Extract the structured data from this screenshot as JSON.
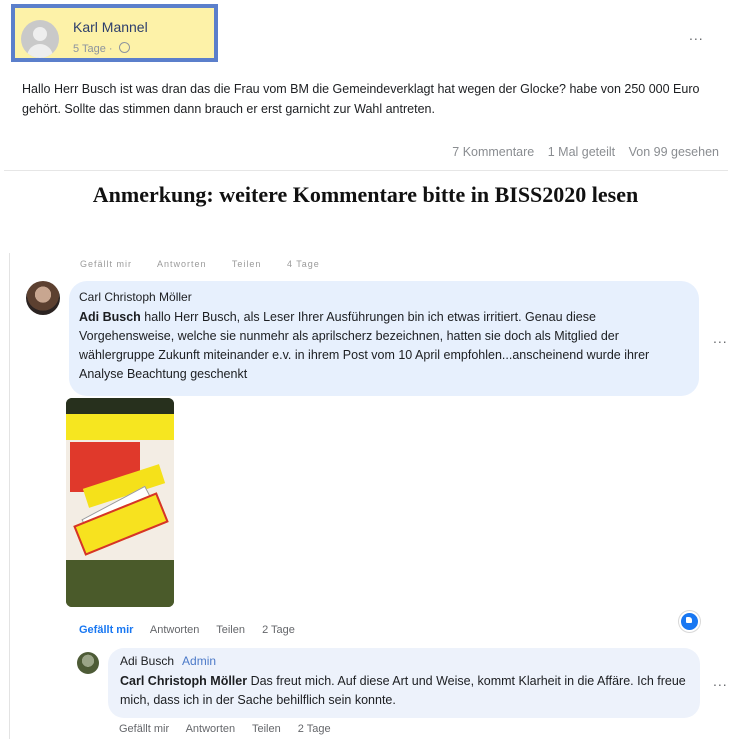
{
  "post": {
    "author": "Karl Mannel",
    "time": "5 Tage",
    "more": "...",
    "text": "Hallo Herr Busch ist was dran das die Frau vom BM die Gemeindeverklagt hat wegen der Glocke? habe von 250 000 Euro gehört. Sollte das stimmen dann brauch er erst garnicht zur Wahl antreten.",
    "comments": "7 Kommentare",
    "shares": "1 Mal geteilt",
    "views": "Von 99 gesehen"
  },
  "notice": "Anmerkung: weitere Kommentare bitte in BISS2020 lesen",
  "cut_row": {
    "like": "Gefällt mir",
    "reply": "Antworten",
    "share": "Teilen",
    "time": "4 Tage"
  },
  "comment": {
    "author": "Carl Christoph Möller",
    "mention": "Adi Busch",
    "text": " hallo Herr Busch, als Leser Ihrer Ausführungen bin ich etwas irritiert. Genau diese Vorgehensweise, welche sie nunmehr als aprilscherz bezeichnen, hatten sie doch als Mitglied der wählergruppe Zukunft miteinander e.v. in ihrem Post vom 10 April empfohlen...anscheinend wurde ihrer Analyse Beachtung geschenkt",
    "more": "...",
    "like": "Gefällt mir",
    "reply": "Antworten",
    "share": "Teilen",
    "time": "2 Tage"
  },
  "reply": {
    "author": "Adi Busch",
    "badge": "Admin",
    "mention": "Carl Christoph Möller",
    "text": " Das freut mich. Auf diese Art und Weise, kommt Klarheit in die Affäre. Ich freue mich, dass ich in der Sache behilflich sein konnte.",
    "more": "...",
    "like": "Gefällt mir",
    "reply_label": "Antworten",
    "share": "Teilen",
    "time": "2 Tage"
  },
  "colors": {
    "highlight_fill": "#fdf2a8",
    "highlight_border": "#5b7fcb",
    "bubble": "#e7f0fd",
    "link_blue": "#1877f2"
  },
  "icons": [
    "avatar-placeholder",
    "globe-icon",
    "more-options-icon",
    "like-reaction-icon"
  ]
}
